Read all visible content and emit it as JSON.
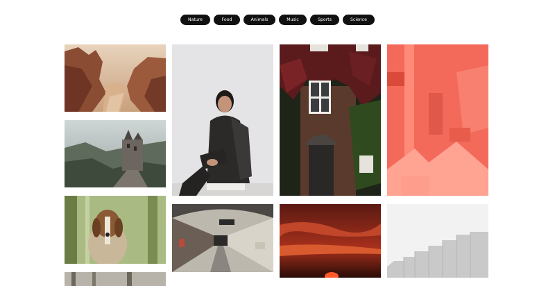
{
  "filters": [
    {
      "label": "Nature"
    },
    {
      "label": "Food"
    },
    {
      "label": "Animals"
    },
    {
      "label": "Music"
    },
    {
      "label": "Sports"
    },
    {
      "label": "Science"
    }
  ],
  "gallery": {
    "photos": [
      {
        "subject": "canyon-rocks"
      },
      {
        "subject": "hilltop-castle"
      },
      {
        "subject": "beagle-dog-in-forest"
      },
      {
        "subject": "forest-bottom"
      },
      {
        "subject": "woman-seated-portrait"
      },
      {
        "subject": "underground-station-platform"
      },
      {
        "subject": "ivy-covered-building-door"
      },
      {
        "subject": "red-sunset-clouds"
      },
      {
        "subject": "coral-pink-architecture"
      },
      {
        "subject": "grey-stepped-buildings"
      }
    ]
  },
  "colors": {
    "pill_bg": "#111111",
    "pill_text": "#ffffff",
    "page_bg": "#ffffff"
  }
}
